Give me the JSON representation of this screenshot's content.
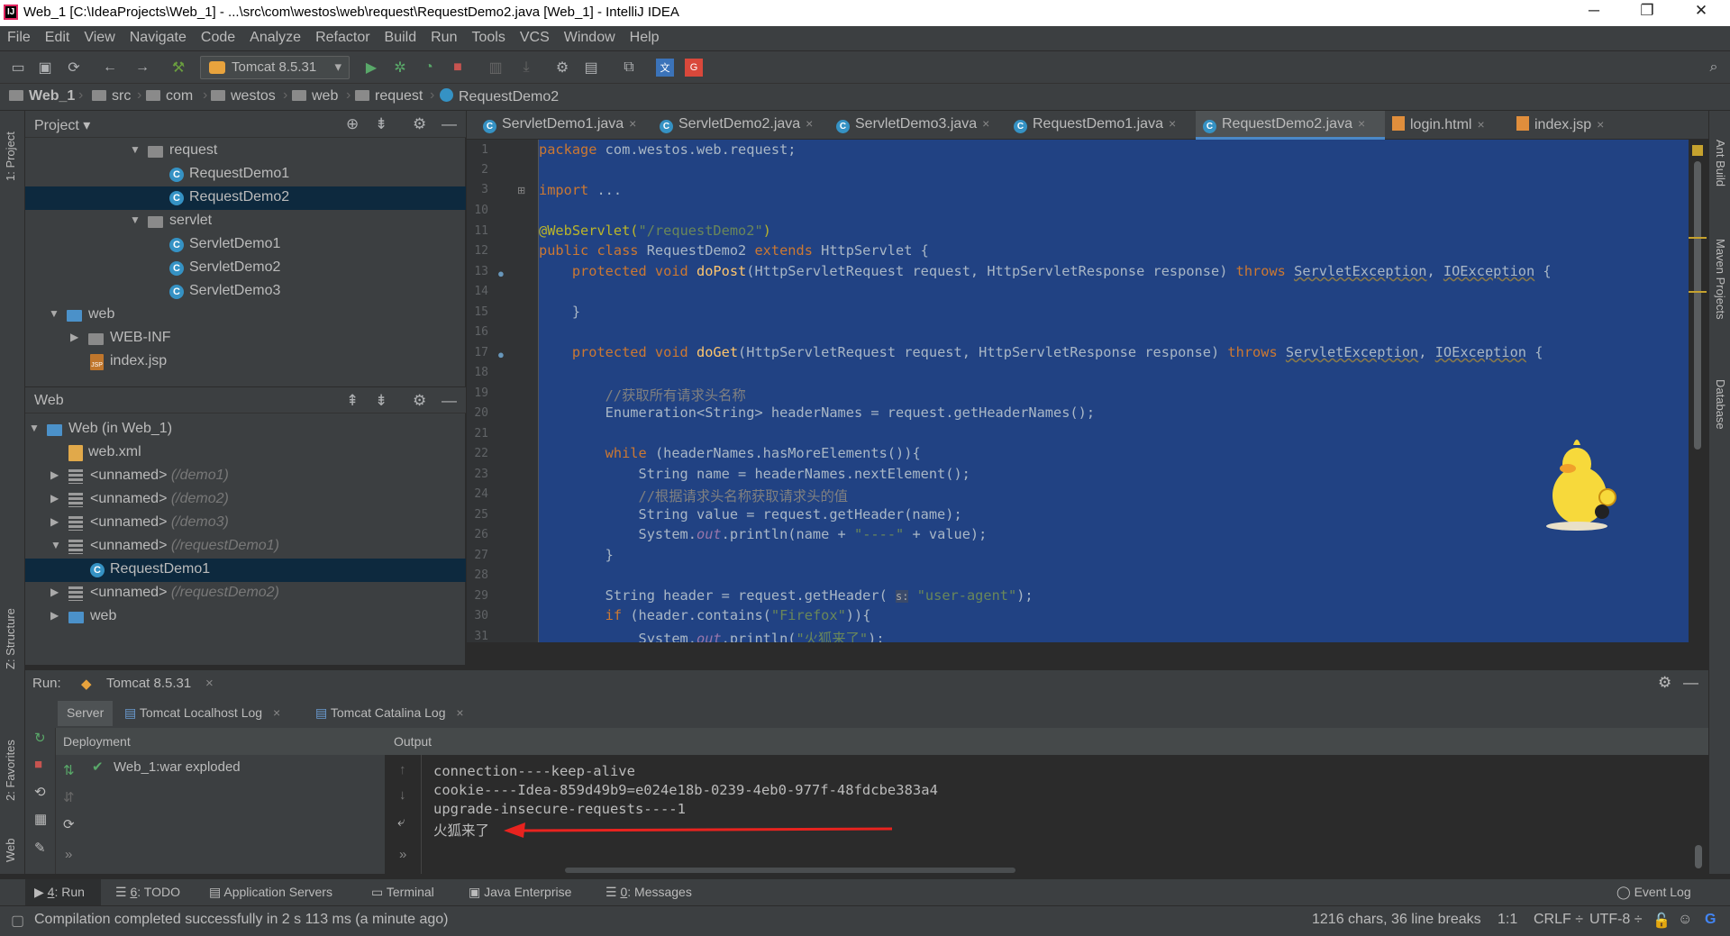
{
  "window": {
    "title": "Web_1 [C:\\IdeaProjects\\Web_1] - ...\\src\\com\\westos\\web\\request\\RequestDemo2.java [Web_1] - IntelliJ IDEA",
    "minimize": "─",
    "restore": "❐",
    "close": "✕"
  },
  "menu": [
    "File",
    "Edit",
    "View",
    "Navigate",
    "Code",
    "Analyze",
    "Refactor",
    "Build",
    "Run",
    "Tools",
    "VCS",
    "Window",
    "Help"
  ],
  "toolbar": {
    "run_config": "Tomcat 8.5.31"
  },
  "breadcrumb": [
    "Web_1",
    "src",
    "com",
    "westos",
    "web",
    "request",
    "RequestDemo2"
  ],
  "project_panel": {
    "title": "Project",
    "dropdown": "▾",
    "tree": [
      {
        "label": "request",
        "arrow": "▼"
      },
      {
        "label": "RequestDemo1"
      },
      {
        "label": "RequestDemo2"
      },
      {
        "label": "servlet",
        "arrow": "▼"
      },
      {
        "label": "ServletDemo1"
      },
      {
        "label": "ServletDemo2"
      },
      {
        "label": "ServletDemo3"
      },
      {
        "label": "web",
        "arrow": "▼"
      },
      {
        "label": "WEB-INF",
        "arrow": "▶"
      },
      {
        "label": "index.jsp"
      }
    ]
  },
  "web_panel": {
    "title": "Web",
    "tree": [
      {
        "label": "Web (in Web_1)",
        "arrow": "▼"
      },
      {
        "label": "web.xml"
      },
      {
        "label": "<unnamed>",
        "hint": "(/demo1)",
        "arrow": "▶"
      },
      {
        "label": "<unnamed>",
        "hint": "(/demo2)",
        "arrow": "▶"
      },
      {
        "label": "<unnamed>",
        "hint": "(/demo3)",
        "arrow": "▶"
      },
      {
        "label": "<unnamed>",
        "hint": "(/requestDemo1)",
        "arrow": "▼"
      },
      {
        "label": "RequestDemo1"
      },
      {
        "label": "<unnamed>",
        "hint": "(/requestDemo2)",
        "arrow": "▶"
      },
      {
        "label": "web",
        "arrow": "▶"
      }
    ]
  },
  "editor_tabs": [
    {
      "label": "ServletDemo1.java"
    },
    {
      "label": "ServletDemo2.java"
    },
    {
      "label": "ServletDemo3.java"
    },
    {
      "label": "RequestDemo1.java"
    },
    {
      "label": "RequestDemo2.java",
      "active": true
    },
    {
      "label": "login.html"
    },
    {
      "label": "index.jsp"
    }
  ],
  "code": {
    "line_numbers": [
      "1",
      "2",
      "3",
      "10",
      "11",
      "12",
      "13",
      "14",
      "15",
      "16",
      "17",
      "18",
      "19",
      "20",
      "21",
      "22",
      "23",
      "24",
      "25",
      "26",
      "27",
      "28",
      "29",
      "30",
      "31"
    ],
    "l1_kw": "package",
    "l1_rest": " com.westos.web.request;",
    "l3_kw": "import",
    "l3_rest": " ...",
    "l11_ann": "@WebServlet(",
    "l11_str": "\"/requestDemo2\"",
    "l11_end": ")",
    "l12_a": "public class",
    "l12_b": " RequestDemo2 ",
    "l12_c": "extends",
    "l12_d": " HttpServlet {",
    "l13_a": "    protected void ",
    "l13_f": "doPost",
    "l13_b": "(HttpServletRequest request, HttpServletResponse response) ",
    "l13_t": "throws",
    "l13_e1": "ServletException",
    "l13_sep": ", ",
    "l13_e2": "IOException",
    "l13_end": " {",
    "l15": "    }",
    "l17_a": "    protected void ",
    "l17_f": "doGet",
    "l17_b": "(HttpServletRequest request, HttpServletResponse response) ",
    "l17_t": "throws",
    "l17_e1": "ServletException",
    "l17_sep": ", ",
    "l17_e2": "IOException",
    "l17_end": " {",
    "l19": "        //获取所有请求头名称",
    "l20": "        Enumeration<String> headerNames = request.getHeaderNames();",
    "l22_kw": "        while",
    "l22_rest": " (headerNames.hasMoreElements()){",
    "l23": "            String name = headerNames.nextElement();",
    "l24": "            //根据请求头名称获取请求头的值",
    "l25": "            String value = request.getHeader(name);",
    "l26_a": "            System.",
    "l26_out": "out",
    "l26_b": ".println(name + ",
    "l26_str": "\"----\"",
    "l26_c": " + value);",
    "l27": "        }",
    "l29_a": "        String header = request.getHeader( ",
    "l29_hint": "s:",
    "l29_sp": " ",
    "l29_str": "\"user-agent\"",
    "l29_end": ");",
    "l30_kw": "        if",
    "l30_a": " (header.contains(",
    "l30_str": "\"Firefox\"",
    "l30_end": ")){",
    "l31_a": "            System.",
    "l31_out": "out",
    "l31_b": ".println(",
    "l31_str": "\"火狐来了\"",
    "l31_end": ");"
  },
  "run": {
    "label": "Run:",
    "config": "Tomcat 8.5.31",
    "tabs": [
      "Server",
      "Tomcat Localhost Log",
      "Tomcat Catalina Log"
    ],
    "deployment_header": "Deployment",
    "output_header": "Output",
    "deployment_item": "Web_1:war exploded",
    "output": [
      "connection----keep-alive",
      "cookie----Idea-859d49b9=e024e18b-0239-4eb0-977f-48fdcbe383a4",
      "upgrade-insecure-requests----1",
      "火狐来了"
    ]
  },
  "bottom_tabs": [
    {
      "num": "4",
      "label": ": Run"
    },
    {
      "num": "6",
      "label": ": TODO"
    },
    {
      "label": "Application Servers"
    },
    {
      "label": "Terminal"
    },
    {
      "label": "Java Enterprise"
    },
    {
      "num": "0",
      "label": ": Messages"
    }
  ],
  "event_log": "Event Log",
  "status": {
    "message": "Compilation completed successfully in 2 s 113 ms (a minute ago)",
    "chars": "1216 chars, 36 line breaks",
    "position": "1:1",
    "line_sep": "CRLF ÷",
    "encoding": "UTF-8 ÷"
  },
  "side_tabs": {
    "left": [
      "1: Project",
      "Z: Structure",
      "2: Favorites",
      "Web"
    ],
    "right": [
      "Ant Build",
      "Maven Projects",
      "Database"
    ]
  },
  "colors": {
    "selection": "#214283",
    "accent": "#4a88c7",
    "arrow": "#e8231f"
  }
}
